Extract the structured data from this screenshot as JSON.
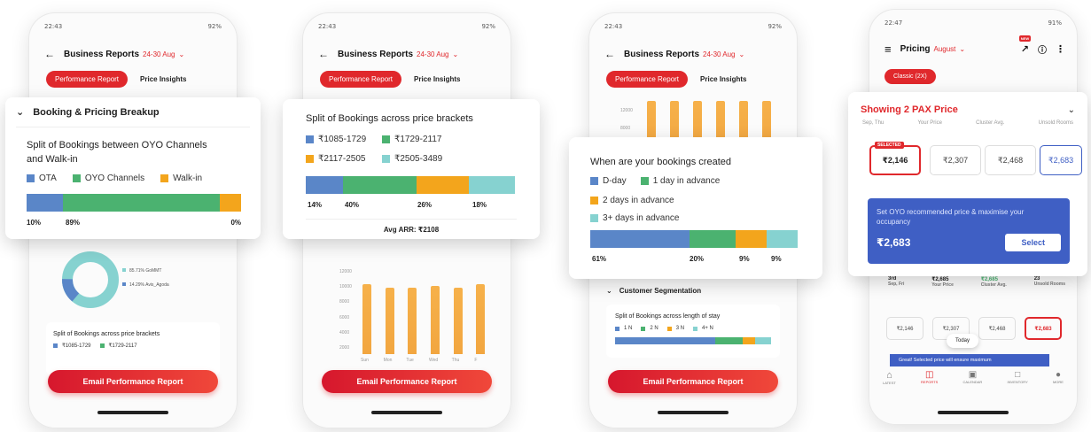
{
  "phone1": {
    "status_left": "22:43",
    "status_right": "92%",
    "title": "Business Reports",
    "date_range": "24-30 Aug",
    "tabs": [
      "Performance Report",
      "Price Insights"
    ],
    "card_title": "Booking & Pricing Breakup",
    "chart_title": "Split of Bookings between OYO Channels and Walk-in",
    "legend": [
      "OTA",
      "OYO Channels",
      "Walk-in"
    ],
    "donut_legend": [
      "85.71% GoMMT",
      "14.29% Avis_Agoda"
    ],
    "bottom_title": "Split of Bookings across price brackets",
    "bottom_legend": [
      "₹1085-1729",
      "₹1729-2117"
    ],
    "email_button": "Email Performance Report"
  },
  "phone2": {
    "status_left": "22:43",
    "status_right": "92%",
    "title": "Business Reports",
    "date_range": "24-30 Aug",
    "tabs": [
      "Performance Report",
      "Price Insights"
    ],
    "chart_title": "Split of Bookings across price brackets",
    "legend": [
      "₹1085-1729",
      "₹1729-2117",
      "₹2117-2505",
      "₹2505-3489"
    ],
    "avg_arr": "Avg ARR: ₹2108",
    "y_ticks": [
      "12000",
      "10000",
      "8000",
      "6000",
      "4000",
      "2000"
    ],
    "x_ticks": [
      "Sun",
      "Mon",
      "Tue",
      "Wed",
      "Thu",
      "F"
    ],
    "email_button": "Email Performance Report"
  },
  "phone3": {
    "status_left": "22:43",
    "status_right": "92%",
    "title": "Business Reports",
    "date_range": "24-30 Aug",
    "tabs": [
      "Performance Report",
      "Price Insights"
    ],
    "y_ticks": [
      "12000",
      "8000"
    ],
    "chart_title": "When are your bookings created",
    "legend": [
      "D-day",
      "1 day in advance",
      "2 days in advance",
      "3+ days in advance"
    ],
    "section_title": "Customer Segmentation",
    "stay_title": "Split of Bookings across length of stay",
    "stay_legend": [
      "1 N",
      "2 N",
      "3 N",
      "4+ N"
    ],
    "email_button": "Email Performance Report"
  },
  "phone4": {
    "status_left": "22:47",
    "status_right": "91%",
    "title": "Pricing",
    "month": "August",
    "new_badge": "NEW",
    "chip": "Classic (2X)",
    "card_title": "Showing 2 PAX Price",
    "col_headers": [
      "Sep, Thu",
      "Your Price",
      "Cluster Avg.",
      "Unsold Rooms"
    ],
    "selected_tag": "SELECTED",
    "prices": [
      "₹2,146",
      "₹2,307",
      "₹2,468",
      "₹2,683"
    ],
    "reco_text": "Set OYO recommended price & maximise your occupancy",
    "reco_price": "₹2,683",
    "select_button": "Select",
    "row_day": "3rd",
    "row_day_sub": "Sep, Fri",
    "row_values": [
      "₹2,685",
      "₹2,685",
      "23"
    ],
    "row_value_labels": [
      "Your Price",
      "Cluster Avg.",
      "Unsold Rooms"
    ],
    "small_prices": [
      "₹2,146",
      "₹2,307",
      "₹2,468",
      "₹2,683"
    ],
    "today": "Today",
    "great_text": "Great! Selected price will ensure maximum",
    "nav": [
      "LATEST",
      "REPORTS",
      "CALENDAR",
      "INVENTORY",
      "MORE"
    ]
  },
  "chart_data": [
    {
      "type": "bar",
      "title": "Split of Bookings between OYO Channels and Walk-in",
      "categories": [
        "OTA",
        "OYO Channels",
        "Walk-in"
      ],
      "values": [
        10,
        89,
        0
      ],
      "unit": "%"
    },
    {
      "type": "bar",
      "title": "Split of Bookings across price brackets",
      "categories": [
        "₹1085-1729",
        "₹1729-2117",
        "₹2117-2505",
        "₹2505-3489"
      ],
      "values": [
        14,
        40,
        26,
        18
      ],
      "unit": "%"
    },
    {
      "type": "bar",
      "categories": [
        "Sun",
        "Mon",
        "Tue",
        "Wed",
        "Thu",
        "F"
      ],
      "values": [
        10500,
        10000,
        10000,
        10300,
        10000,
        10500
      ],
      "ylim": [
        0,
        12000
      ]
    },
    {
      "type": "bar",
      "title": "When are your bookings created",
      "categories": [
        "D-day",
        "1 day in advance",
        "2 days in advance",
        "3+ days in advance"
      ],
      "values": [
        61,
        20,
        9,
        9
      ],
      "unit": "%"
    }
  ]
}
